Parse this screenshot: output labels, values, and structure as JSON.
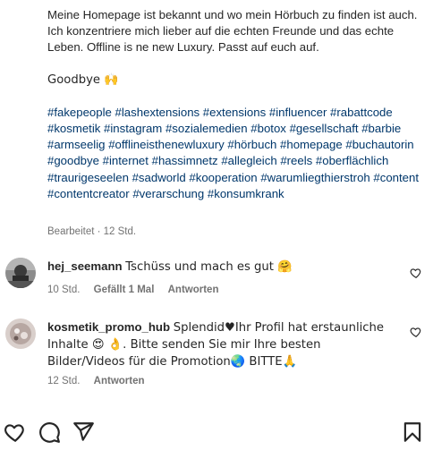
{
  "caption": {
    "paragraph1": "Meine Homepage ist bekannt und wo mein Hörbuch zu finden ist auch. Ich konzentriere mich lieber auf die echten Freunde und das echte Leben. Offline is ne new Luxury. Passt auf euch auf.",
    "paragraph2": "Goodbye 🙌",
    "hashtags": [
      "#fakepeople",
      "#lashextensions",
      "#extensions",
      "#influencer",
      "#rabattcode",
      "#kosmetik",
      "#instagram",
      "#sozialemedien",
      "#botox",
      "#gesellschaft",
      "#barbie",
      "#armseelig",
      "#offlineisthenewluxury",
      "#hörbuch",
      "#homepage",
      "#buchautorin",
      "#goodbye",
      "#internet",
      "#hassimnetz",
      "#allegleich",
      "#reels",
      "#oberflächlich",
      "#traurigeseelen",
      "#sadworld",
      "#kooperation",
      "#warumliegthierstroh",
      "#content",
      "#contentcreator",
      "#verarschung",
      "#konsumkrank"
    ],
    "meta": "Bearbeitet · 12 Std."
  },
  "comments": [
    {
      "username": "hej_seemann",
      "text": "Tschüss und mach es gut 🤗",
      "time": "10 Std.",
      "likes": "Gefällt 1 Mal",
      "reply": "Antworten"
    },
    {
      "username": "kosmetik_promo_hub",
      "text": "Splendid♥Ihr Profil hat erstaunliche Inhalte 😍 👌. Bitte senden Sie mir Ihre besten Bilder/Videos für die Promotion🌏 BITTE🙏",
      "time": "12 Std.",
      "reply": "Antworten"
    }
  ],
  "icons": {
    "like": "heart-icon",
    "comment": "comment-icon",
    "share": "send-icon",
    "save": "bookmark-icon",
    "comment_like": "heart-outline-icon"
  }
}
